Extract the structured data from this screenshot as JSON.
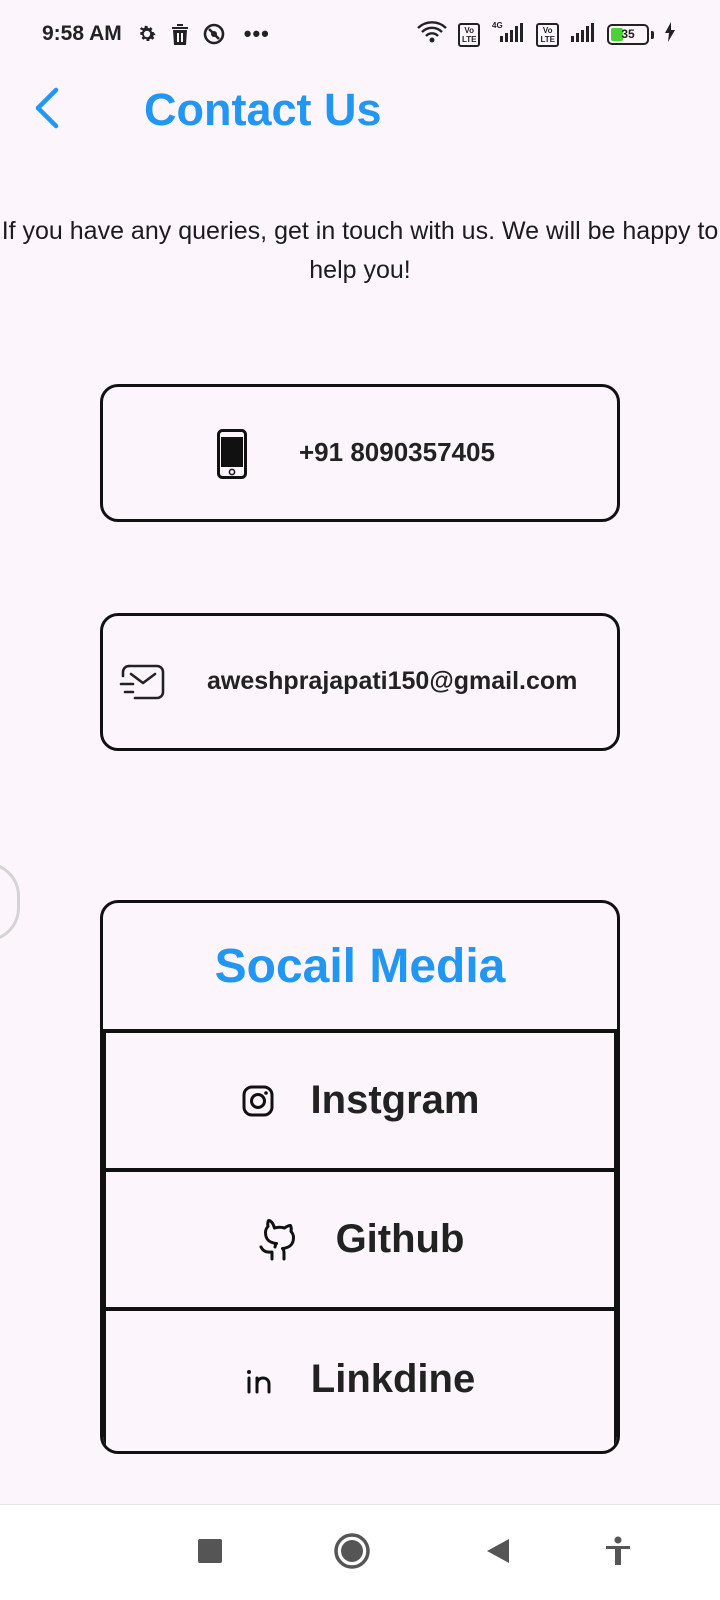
{
  "status_bar": {
    "time": "9:58 AM",
    "network_label": "4G",
    "sim1_label": "Vo\nLTE",
    "sim2_label": "Vo\nLTE",
    "battery_level": "35",
    "battery_fraction": 0.35,
    "charging": true,
    "more_indicator": "•••"
  },
  "header": {
    "title": "Contact Us",
    "back_icon": "chevron-left-icon"
  },
  "intro": {
    "text": "If you have any queries, get in touch with us. We will be happy to help you!"
  },
  "contacts": {
    "phone": "+91 8090357405",
    "email": "aweshprajapati150@gmail.com"
  },
  "social": {
    "heading": "Socail Media",
    "items": [
      {
        "label": "Instgram",
        "icon": "instagram-icon"
      },
      {
        "label": "Github",
        "icon": "github-icon"
      },
      {
        "label": "Linkdine",
        "icon": "linkedin-icon"
      }
    ]
  },
  "colors": {
    "accent": "#2196f3",
    "background": "#fcf6fc",
    "border": "#111111",
    "battery_fill": "#4cd137"
  }
}
